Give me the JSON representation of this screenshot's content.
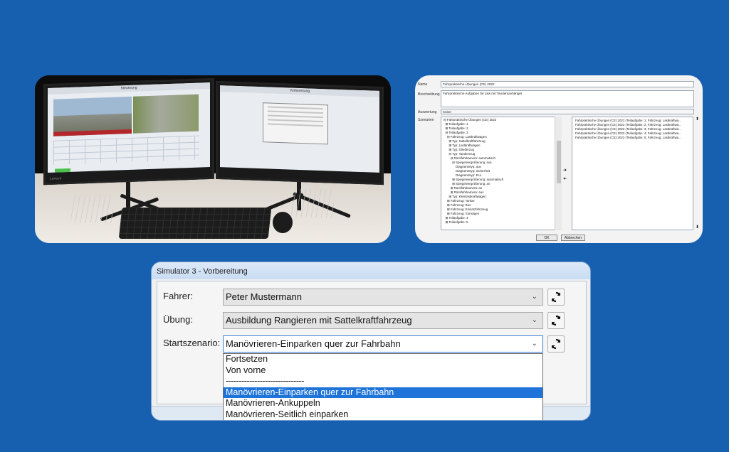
{
  "photo": {
    "left_monitor_title": "Steuerung",
    "right_monitor_title": "Vorbereitung",
    "monitor_brand": "Lenovo"
  },
  "config_dialog": {
    "name_label": "Name",
    "name_value": "Fahrpraktische Übungen (CE) 2022",
    "description_label": "Beschreibung",
    "description_value": "Fahrpraktische Aufgaben für Lkw mit Tandemanhänger",
    "evaluation_label": "Auswertung",
    "evaluation_value": "Keine",
    "scenarios_label": "Szenarien",
    "tree": [
      "⊟ Fahrpraktische Übungen (CE) 2022",
      "  ⊞ Teilaufgabe: 1",
      "  ⊞ Teilaufgabe: 2",
      "  ⊟ Teilaufgabe: 3",
      "    ⊟ Fahrzeug: Lastkraftwagen",
      "      ⊞ Typ: Sattelkraftfahrzeug",
      "      ⊞ Typ: Lastkraftwagen",
      "      ⊞ Typ: Gliederzug",
      "      ⊟ Typ: Tandemzug",
      "        ⊟ Rückfahrkamera: automatisch",
      "          ⊟ Spiegelvergrößerung: aus",
      "              Diagrammtyp: aus",
      "              Diagrammtyp: Sicherheit",
      "              Diagrammtyp: Eco",
      "          ⊞ Spiegelvergrößerung: automatisch",
      "          ⊞ Spiegelvergrößerung: an",
      "        ⊞ Rückfahrkamera: an",
      "        ⊞ Rückfahrkamera: aus",
      "      ⊞ Typ: Kleinlastkraftwagen",
      "    ⊞ Fahrzeug: Tanker",
      "    ⊞ Fahrzeug: Bus",
      "    ⊞ Fahrzeug: Einsatzfahrzeug",
      "    ⊞ Fahrzeug: Sonstiges",
      "  ⊞ Teilaufgabe: 4",
      "  ⊞ Teilaufgabe: 5"
    ],
    "selected_list": [
      "Fahrpraktische Übungen (CE) 2022 (Teilaufgabe: 1; Fahrzeug: Lastkraftwa...",
      "Fahrpraktische Übungen (CE) 2022 (Teilaufgabe: 2; Fahrzeug: Lastkraftwa...",
      "Fahrpraktische Übungen (CE) 2022 (Teilaufgabe: 3; Fahrzeug: Lastkraftwa...",
      "Fahrpraktische Übungen (CE) 2022 (Teilaufgabe: 4; Fahrzeug: Lastkraftwa...",
      "Fahrpraktische Übungen (CE) 2022 (Teilaufgabe: 5; Fahrzeug: Lastkraftwa..."
    ],
    "ok_label": "OK",
    "cancel_label": "Abbrechen"
  },
  "sim_dialog": {
    "title": "Simulator 3 - Vorbereitung",
    "driver_label": "Fahrer:",
    "driver_value": "Peter Mustermann",
    "exercise_label": "Übung:",
    "exercise_value": "Ausbildung Rangieren mit Sattelkraftfahrzeug",
    "scenario_label": "Startszenario:",
    "scenario_value": "Manövrieren-Einparken quer zur Fahrbahn",
    "dropdown_options": [
      "Fortsetzen",
      "Von vorne",
      "------------------------------",
      "Manövrieren-Einparken quer zur Fahrbahn",
      "Manövrieren-Ankuppeln",
      "Manövrieren-Seitlich einparken"
    ],
    "selected_option_index": 3
  }
}
